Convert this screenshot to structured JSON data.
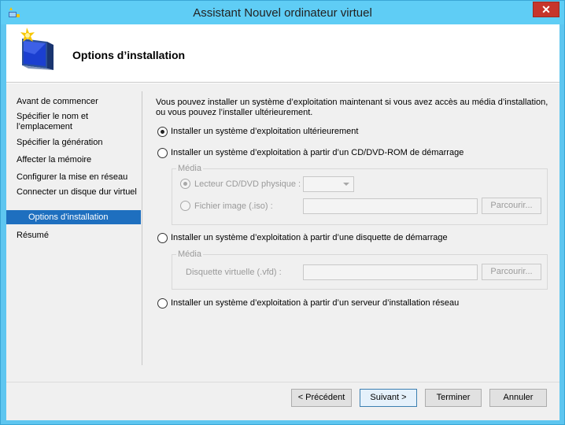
{
  "window": {
    "title": "Assistant Nouvel ordinateur virtuel",
    "close_glyph": "✕"
  },
  "header": {
    "title": "Options d’installation",
    "icon": "wizard-computer-icon"
  },
  "nav": {
    "items": [
      {
        "label": "Avant de commencer",
        "selected": false
      },
      {
        "label": "Spécifier le nom et l’emplacement",
        "selected": false
      },
      {
        "label": "Spécifier la génération",
        "selected": false
      },
      {
        "label": "Affecter la mémoire",
        "selected": false
      },
      {
        "label": "Configurer la mise en réseau",
        "selected": false
      },
      {
        "label": "Connecter un disque dur virtuel",
        "selected": false
      },
      {
        "label": "Options d’installation",
        "selected": true
      },
      {
        "label": "Résumé",
        "selected": false
      }
    ]
  },
  "content": {
    "intro": "Vous pouvez installer un système d’exploitation maintenant si vous avez accès au média d’installation, ou vous pouvez l’installer ultérieurement.",
    "options": {
      "later": "Installer un système d’exploitation ultérieurement",
      "cd": "Installer un système d’exploitation à partir d’un CD/DVD-ROM de démarrage",
      "floppy": "Installer un système d’exploitation à partir d’une disquette de démarrage",
      "network": "Installer un système d’exploitation à partir d’un serveur d’installation réseau"
    },
    "selected_option": "later",
    "cd_group": {
      "legend": "Média",
      "physical_drive_label": "Lecteur CD/DVD physique :",
      "physical_drive_value": "",
      "iso_label": "Fichier image (.iso) :",
      "iso_value": "",
      "browse_label": "Parcourir..."
    },
    "floppy_group": {
      "legend": "Média",
      "vfd_label": "Disquette virtuelle (.vfd) :",
      "vfd_value": "",
      "browse_label": "Parcourir..."
    }
  },
  "footer": {
    "previous": "< Précédent",
    "next": "Suivant >",
    "finish": "Terminer",
    "cancel": "Annuler"
  }
}
